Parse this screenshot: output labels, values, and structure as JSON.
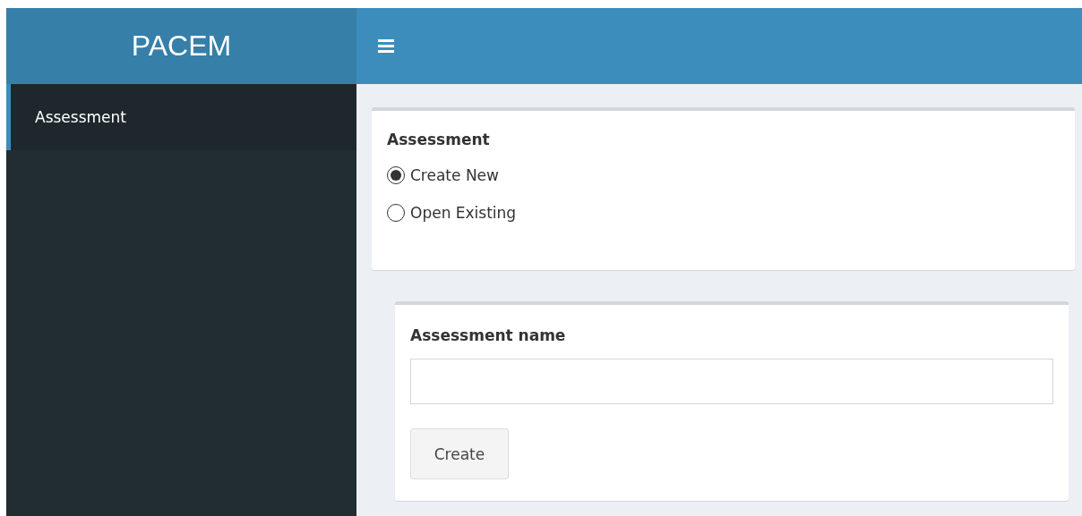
{
  "header": {
    "logo": "PACEM"
  },
  "sidebar": {
    "items": [
      {
        "label": "Assessment",
        "selected": true
      }
    ]
  },
  "assessment_box": {
    "label": "Assessment",
    "options": [
      {
        "label": "Create New",
        "selected": true
      },
      {
        "label": "Open Existing",
        "selected": false
      }
    ]
  },
  "create_box": {
    "label": "Assessment name",
    "button": "Create"
  }
}
